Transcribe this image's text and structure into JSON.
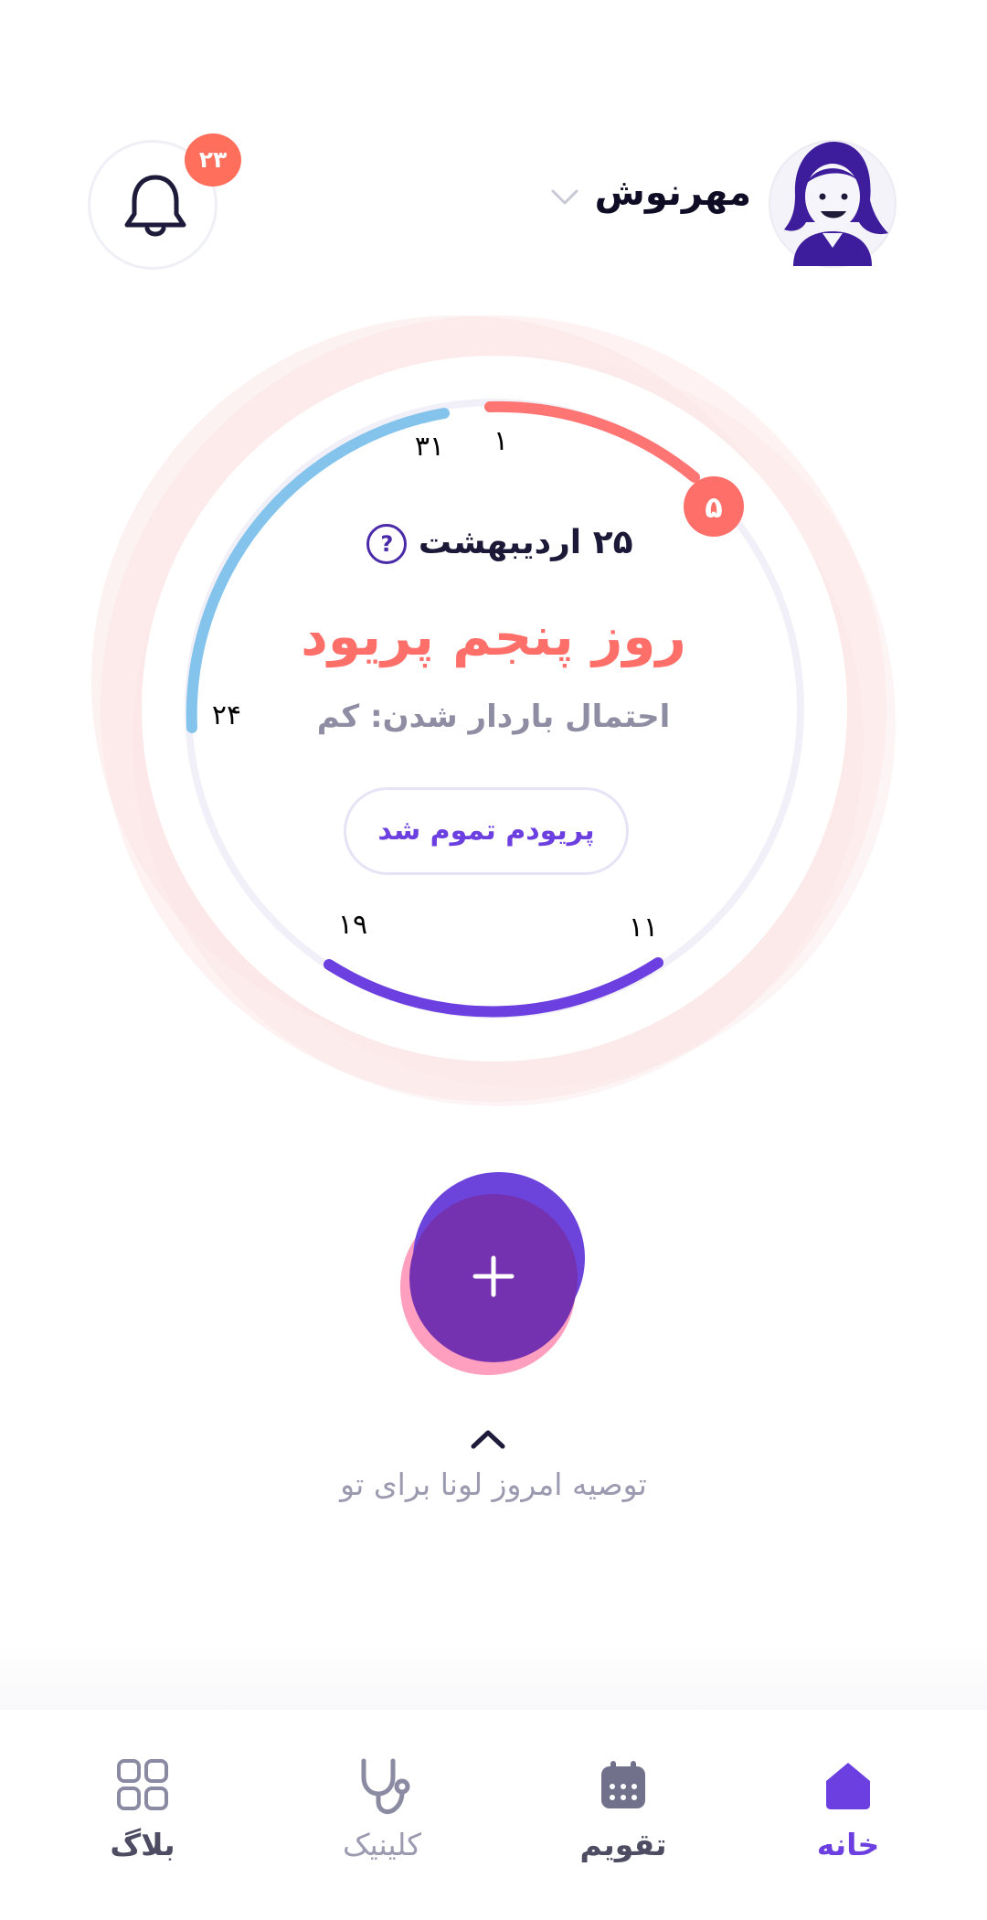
{
  "header": {
    "user_name": "مهرنوش",
    "notification_count": "۲۳"
  },
  "cycle": {
    "date_label": "۲۵ اردیبهشت",
    "day_title": "روز پنجم پریود",
    "pregnancy_chance": "احتمال باردار شدن: کم",
    "end_period_button": "پریودم تموم شد",
    "current_day_marker": "۵",
    "markers": {
      "day_1": "۱",
      "day_31": "۳۱",
      "day_24": "۲۴",
      "day_19": "۱۹",
      "day_11": "۱۱"
    }
  },
  "tip": {
    "label": "توصیه امروز لونا برای تو"
  },
  "nav": {
    "items": [
      {
        "label": "خانه",
        "icon": "home-icon",
        "active": true
      },
      {
        "label": "تقویم",
        "icon": "calendar-icon",
        "active": false
      },
      {
        "label": "کلینیک",
        "icon": "stethoscope-icon",
        "active": false
      },
      {
        "label": "بلاگ",
        "icon": "grid-icon",
        "active": false
      }
    ]
  },
  "colors": {
    "period": "#ff6f6a",
    "fertile": "#6c3fe0",
    "luteal": "#84c4ec",
    "badge": "#ff6f5b",
    "active_nav": "#6c3fe0",
    "inactive_nav": "#8b8aa3"
  }
}
